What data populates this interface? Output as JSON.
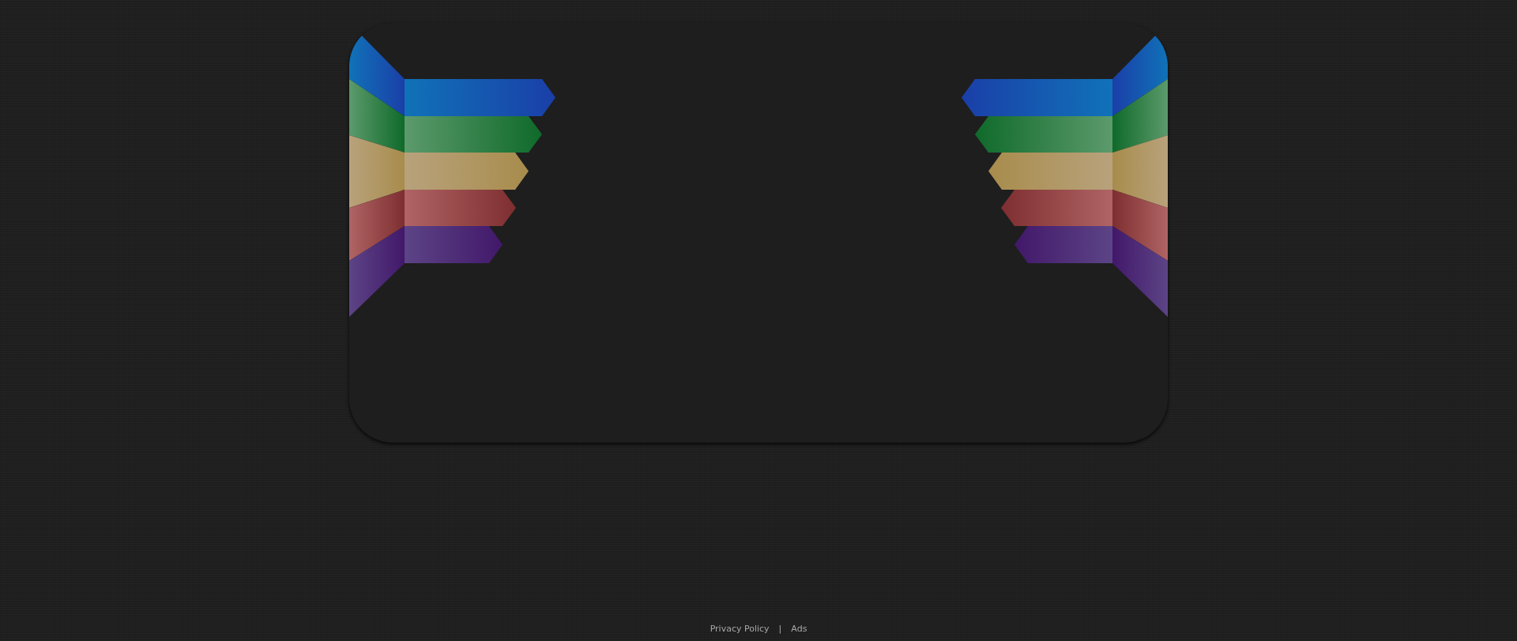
{
  "footer": {
    "links": [
      {
        "label": "Privacy Policy"
      },
      {
        "label": "Ads"
      }
    ],
    "separator": "|"
  }
}
